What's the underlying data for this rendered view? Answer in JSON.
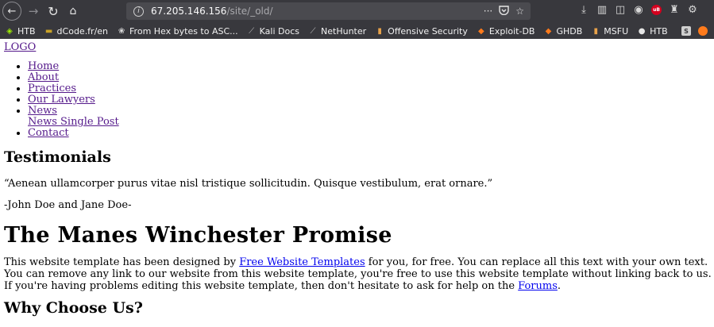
{
  "browser": {
    "url_host": "67.205.146.156",
    "url_path": "/site/_old/",
    "bookmarks": [
      {
        "icon": "htb-cube-icon",
        "glyph": "◈",
        "color": "#9fef00",
        "label": "HTB"
      },
      {
        "icon": "dcode-icon",
        "glyph": "▬",
        "color": "#c9a227",
        "label": "dCode.fr/en"
      },
      {
        "icon": "hex-bytes-icon",
        "glyph": "❀",
        "color": "#dddddd",
        "label": "From Hex bytes to ASC..."
      },
      {
        "icon": "kali-dragon-icon",
        "glyph": "⟋",
        "color": "#bcbcbc",
        "label": "Kali Docs"
      },
      {
        "icon": "kali-dragon-icon",
        "glyph": "⟋",
        "color": "#bcbcbc",
        "label": "NetHunter"
      },
      {
        "icon": "offsec-icon",
        "glyph": "▮",
        "color": "#e8a24a",
        "label": "Offensive Security"
      },
      {
        "icon": "exploit-db-icon",
        "glyph": "◆",
        "color": "#ff7b1c",
        "label": "Exploit-DB"
      },
      {
        "icon": "ghdb-icon",
        "glyph": "◆",
        "color": "#ff7b1c",
        "label": "GHDB"
      },
      {
        "icon": "offsec-icon",
        "glyph": "▮",
        "color": "#e8a24a",
        "label": "MSFU"
      },
      {
        "icon": "github-icon",
        "glyph": "●",
        "color": "#e6e6e6",
        "label": "HTB"
      }
    ]
  },
  "page": {
    "logo": "LOGO",
    "nav": [
      {
        "label": "Home"
      },
      {
        "label": "About"
      },
      {
        "label": "Practices"
      },
      {
        "label": "Our Lawyers"
      },
      {
        "label": "News"
      },
      {
        "label": "Contact"
      }
    ],
    "news_sub": "News Single Post",
    "testimonials_heading": "Testimonials",
    "quote": "“Aenean ullamcorper purus vitae nisl tristique sollicitudin. Quisque vestibulum, erat ornare.”",
    "author": "-John Doe and Jane Doe-",
    "promise_heading": "The Manes Winchester Promise",
    "body_part1": "This website template has been designed by ",
    "body_link1": "Free Website Templates",
    "body_part2": " for you, for free. You can replace all this text with your own text. You can remove any link to our website from this website template, you're free to use this website template without linking back to us. If you're having problems editing this website template, then don't hesitate to ask for help on the ",
    "body_link2": "Forums",
    "body_part3": ".",
    "why_heading": "Why Choose Us?"
  }
}
